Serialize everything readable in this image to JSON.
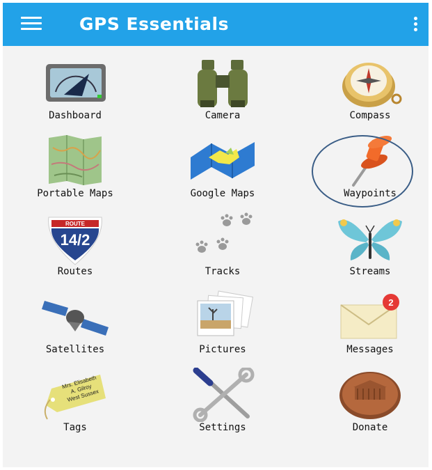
{
  "app": {
    "title": "GPS Essentials"
  },
  "tiles": [
    {
      "label": "Dashboard"
    },
    {
      "label": "Camera"
    },
    {
      "label": "Compass"
    },
    {
      "label": "Portable Maps"
    },
    {
      "label": "Google Maps"
    },
    {
      "label": "Waypoints"
    },
    {
      "label": "Routes",
      "sign_top": "ROUTE",
      "sign_number": "14/2"
    },
    {
      "label": "Tracks"
    },
    {
      "label": "Streams"
    },
    {
      "label": "Satellites"
    },
    {
      "label": "Pictures"
    },
    {
      "label": "Messages",
      "badge": "2"
    },
    {
      "label": "Tags",
      "tag_text": [
        "Mrs. Elisabeth",
        "A. Gilroy",
        "West Sussex"
      ]
    },
    {
      "label": "Settings"
    },
    {
      "label": "Donate"
    }
  ],
  "colors": {
    "appbar": "#22a2e8",
    "highlight": "#3a5d86"
  }
}
